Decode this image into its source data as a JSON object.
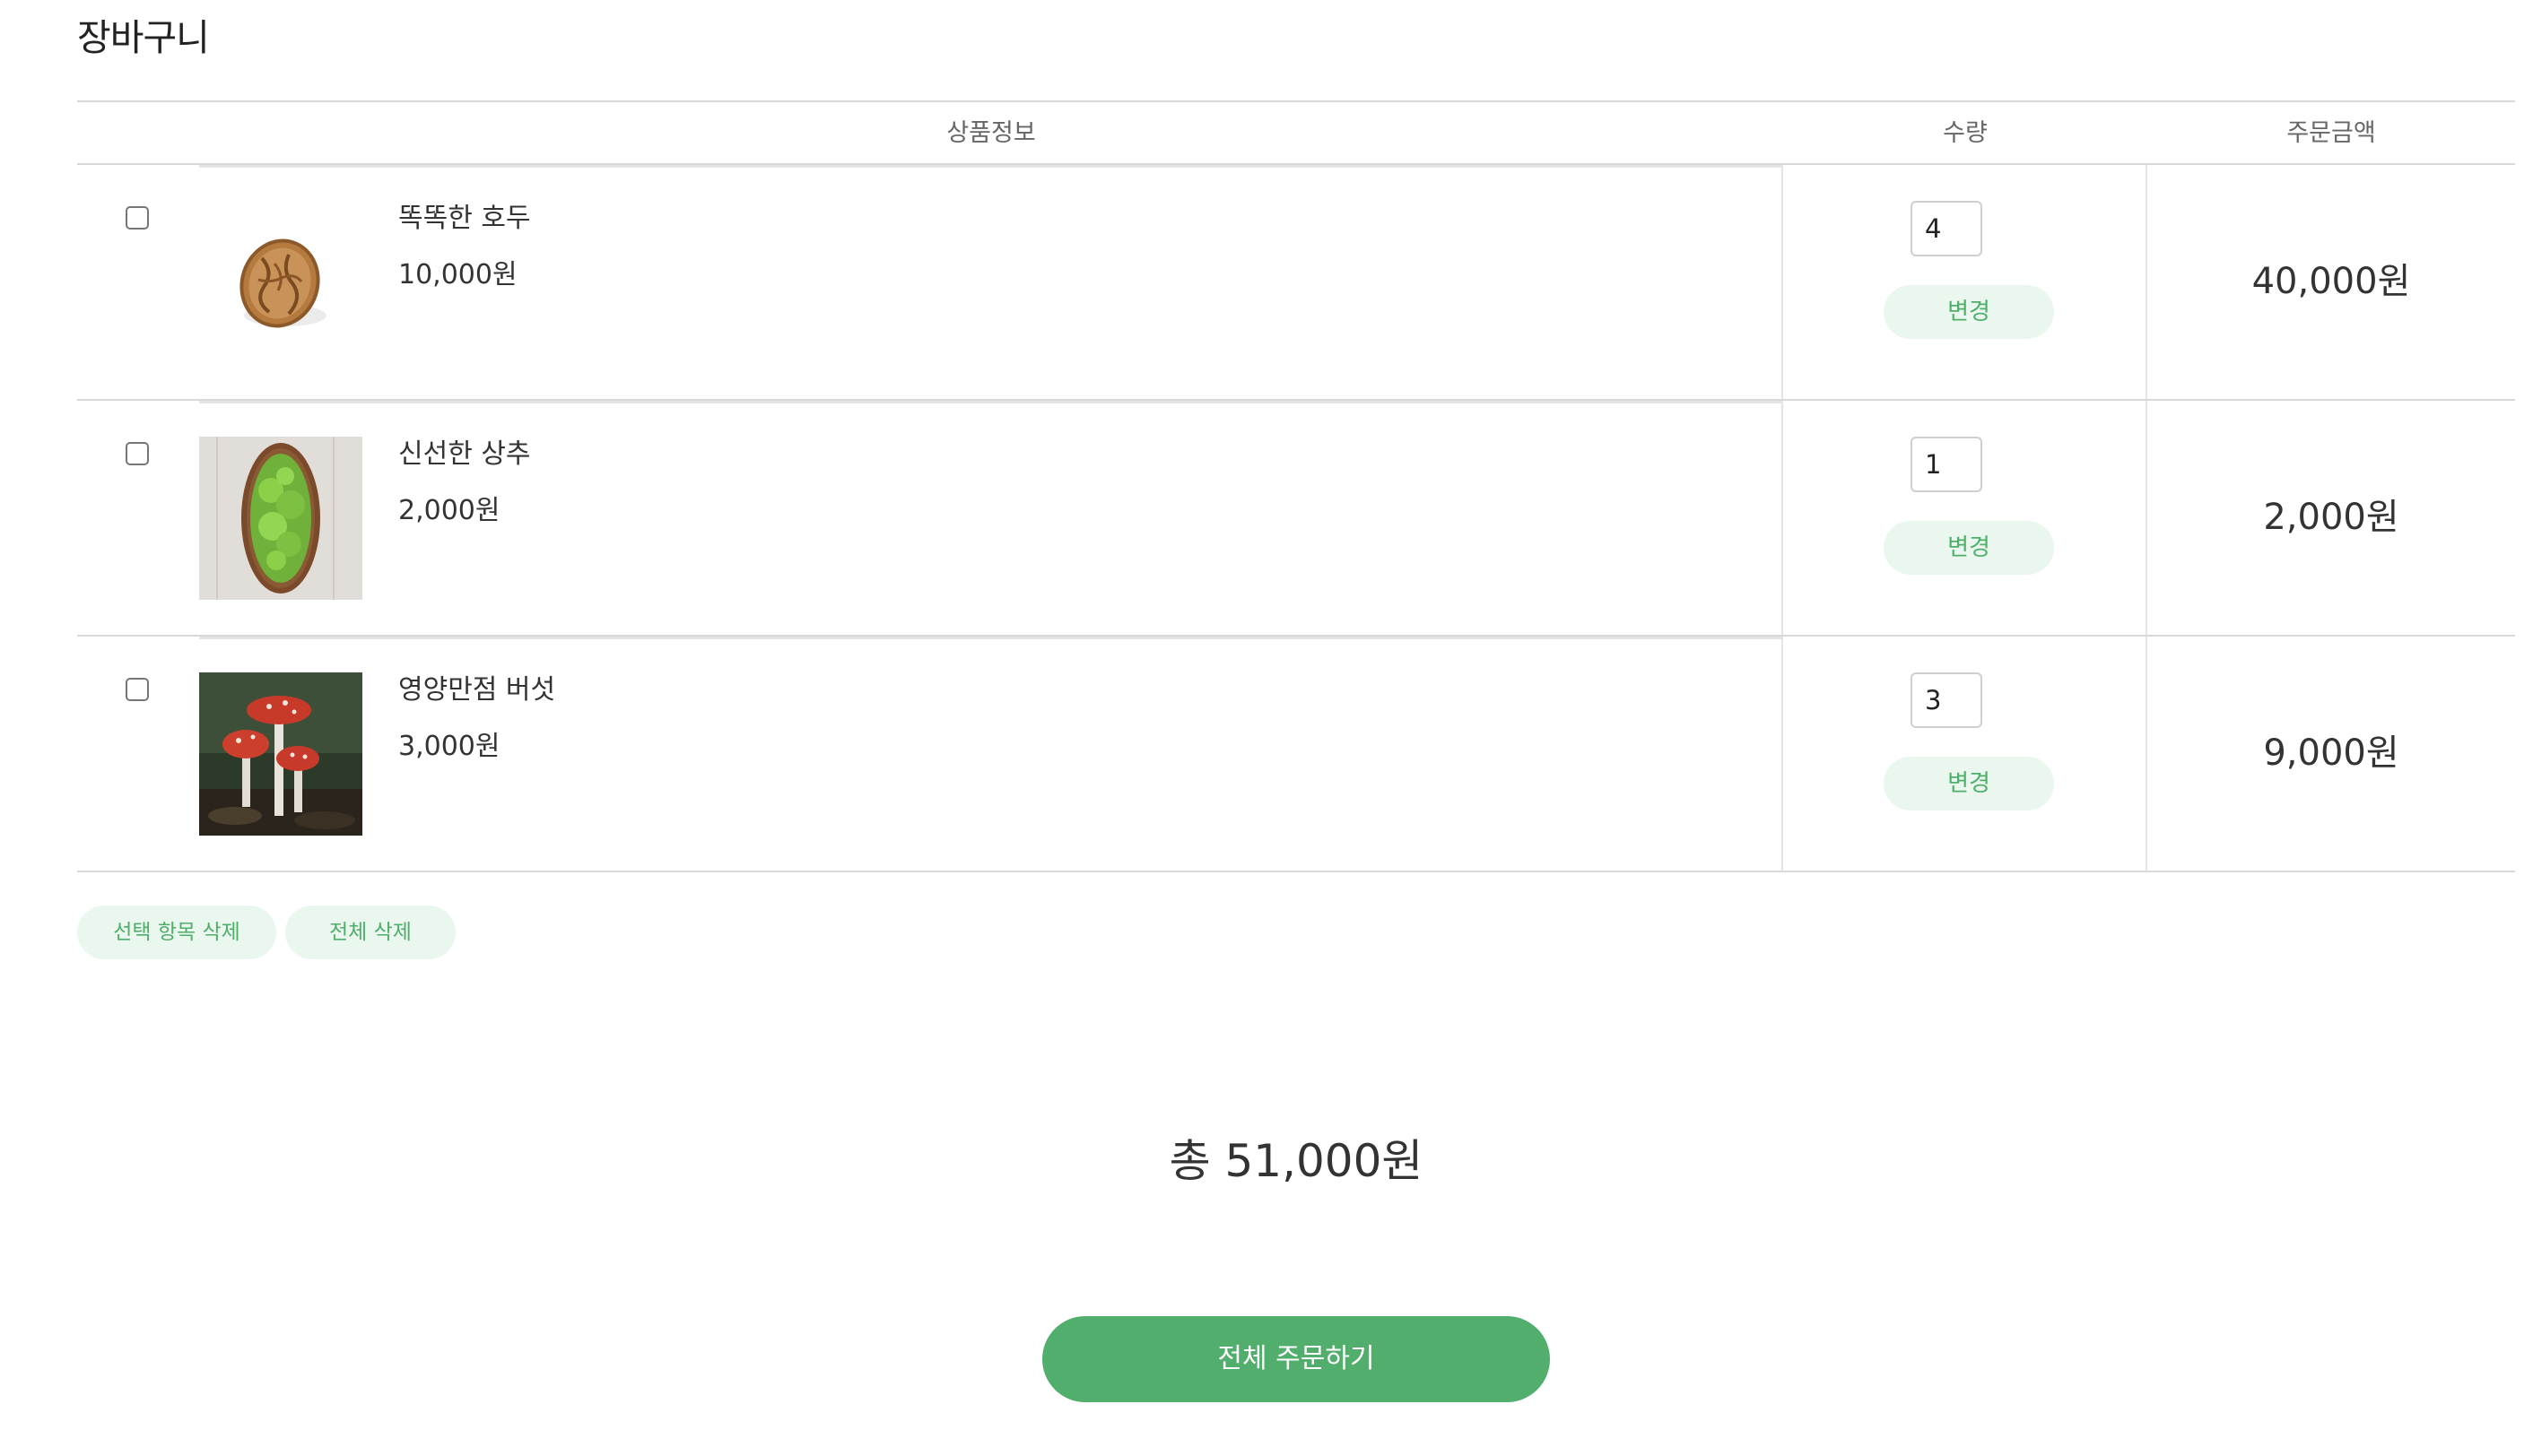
{
  "page": {
    "title": "장바구니"
  },
  "table": {
    "headers": {
      "info": "상품정보",
      "quantity": "수량",
      "price": "주문금액"
    },
    "rows": [
      {
        "name": "똑똑한 호두",
        "unit_price": "10,000원",
        "quantity": "4",
        "change_label": "변경",
        "row_total": "40,000원",
        "image": "walnut"
      },
      {
        "name": "신선한 상추",
        "unit_price": "2,000원",
        "quantity": "1",
        "change_label": "변경",
        "row_total": "2,000원",
        "image": "lettuce"
      },
      {
        "name": "영양만점 버섯",
        "unit_price": "3,000원",
        "quantity": "3",
        "change_label": "변경",
        "row_total": "9,000원",
        "image": "mushroom"
      }
    ]
  },
  "actions": {
    "delete_selected": "선택 항목 삭제",
    "delete_all": "전체 삭제"
  },
  "summary": {
    "total": "총 51,000원",
    "order_all": "전체 주문하기"
  },
  "colors": {
    "accent": "#52ae6c",
    "accent_light": "#eaf7ee",
    "accent_text": "#4fae6a"
  }
}
